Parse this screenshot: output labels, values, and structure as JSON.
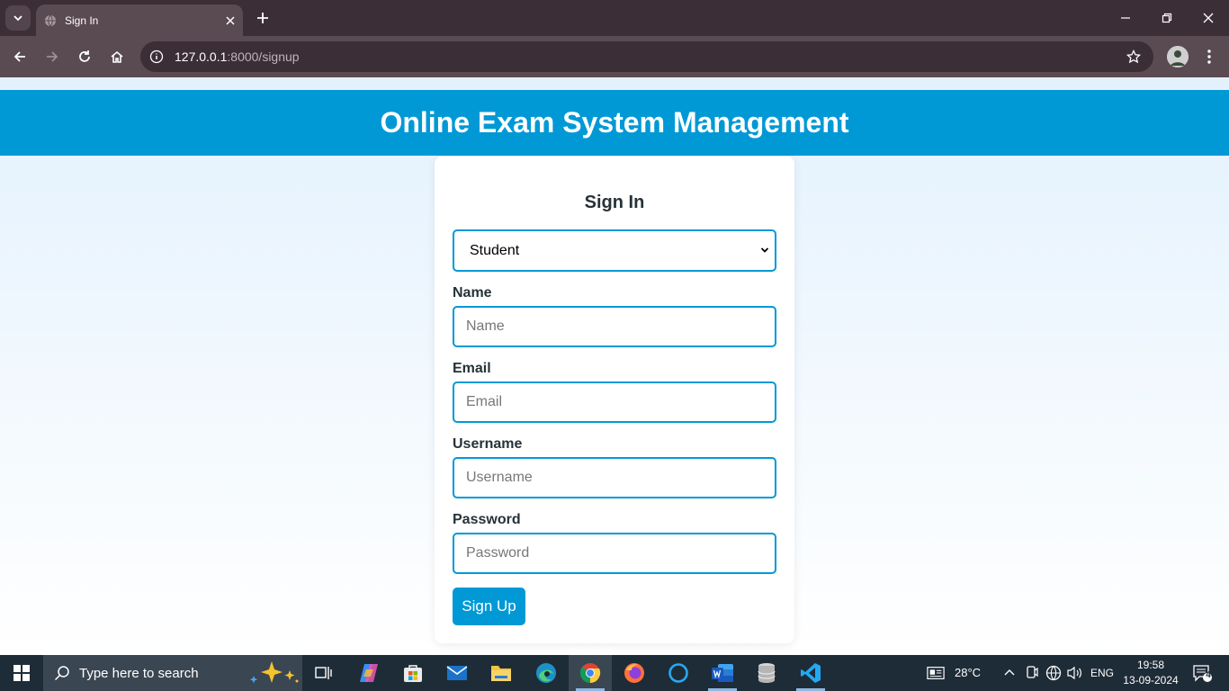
{
  "browser": {
    "tab_title": "Sign In",
    "url_host": "127.0.0.1",
    "url_path": ":8000/signup"
  },
  "page": {
    "header_title": "Online Exam System Management",
    "card_title": "Sign In",
    "role_select": {
      "selected": "Student"
    },
    "fields": {
      "name": {
        "label": "Name",
        "placeholder": "Name"
      },
      "email": {
        "label": "Email",
        "placeholder": "Email"
      },
      "username": {
        "label": "Username",
        "placeholder": "Username"
      },
      "password": {
        "label": "Password",
        "placeholder": "Password"
      }
    },
    "submit_label": "Sign Up"
  },
  "taskbar": {
    "search_placeholder": "Type here to search",
    "weather": "28°C",
    "language": "ENG",
    "time": "19:58",
    "date": "13-09-2024",
    "notification_count": "4",
    "apps": [
      "task-view",
      "copilot",
      "microsoft-store",
      "mail",
      "file-explorer",
      "edge",
      "chrome",
      "firefox",
      "cortana",
      "word",
      "database-tool",
      "vscode"
    ]
  },
  "colors": {
    "accent": "#0099d6",
    "tab_bar": "#3c2e36",
    "toolbar": "#5a4a52",
    "taskbar": "#1e2c38"
  }
}
